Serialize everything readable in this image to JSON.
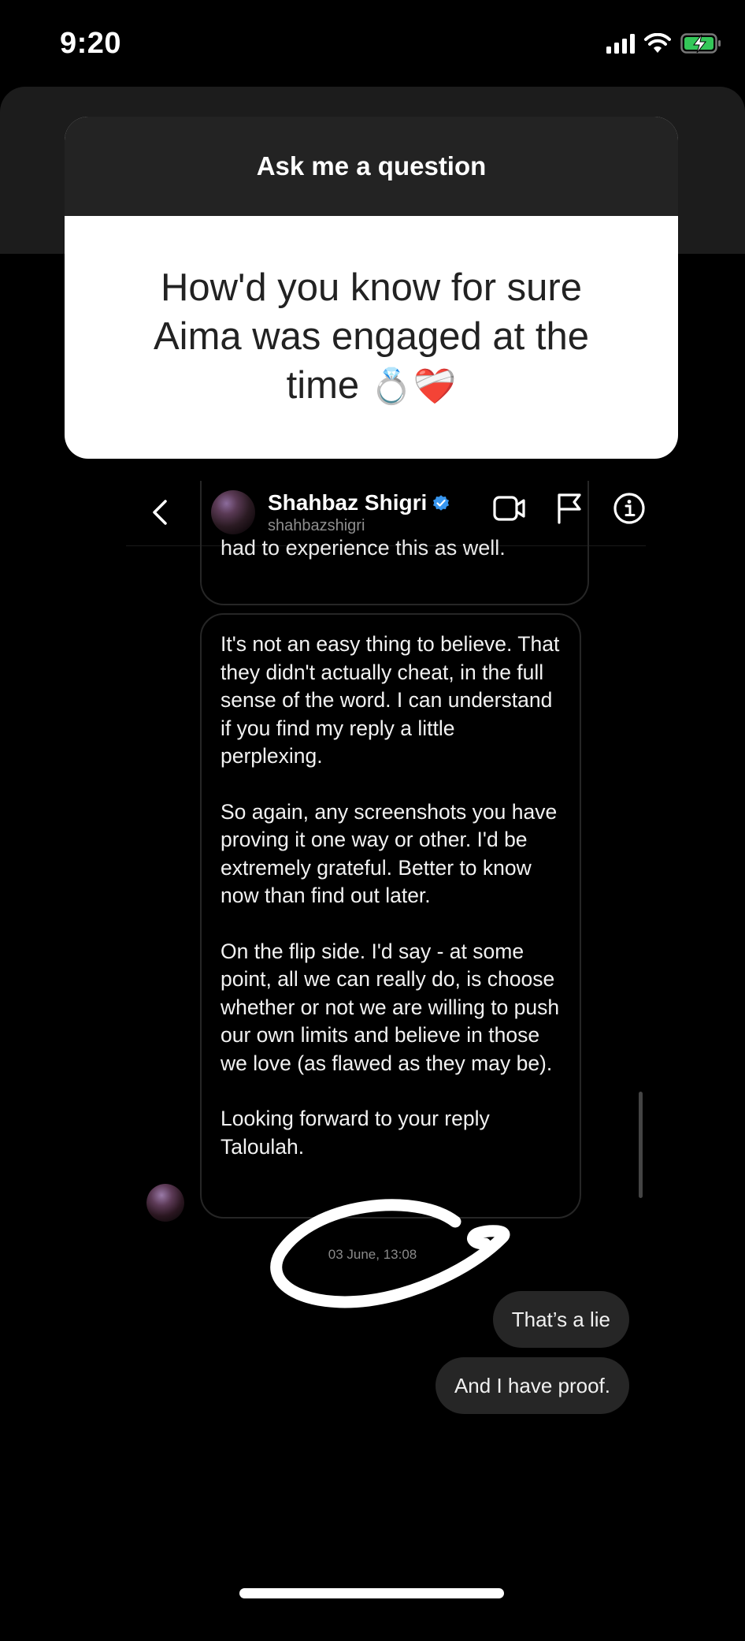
{
  "status_bar": {
    "time": "9:20",
    "icons": [
      "cellular-signal-icon",
      "wifi-icon",
      "battery-charging-icon"
    ],
    "battery_color": "#34c759"
  },
  "question_sticker": {
    "header": "Ask me a question",
    "question_text": "How'd you know for sure Aima was engaged at the time",
    "emojis": "💍❤️‍🩹"
  },
  "dm_header": {
    "name": "Shahbaz Shigri",
    "handle": "shahbazshigri",
    "verified": true,
    "verified_color": "#3897f0",
    "actions": [
      "back-icon",
      "video-call-icon",
      "report-flag-icon",
      "info-icon"
    ]
  },
  "messages": {
    "previous_partial": "had to experience this as well.",
    "main_paragraphs": [
      "It's not an easy thing to believe. That they didn't actually cheat, in the full sense of the word. I can understand if you find my reply a little perplexing.",
      "So again, any screenshots you have proving it one way or other. I'd be extremely grateful. Better to know now than find out later.",
      "On the flip side. I'd say - at some point, all we can really do, is choose whether or not we are willing to push our own limits and believe in those we love (as flawed as they may be).",
      "Looking forward to your reply Taloulah."
    ],
    "timestamp": "03 June, 13:08",
    "outgoing": [
      "That’s a lie",
      "And I have proof."
    ]
  }
}
